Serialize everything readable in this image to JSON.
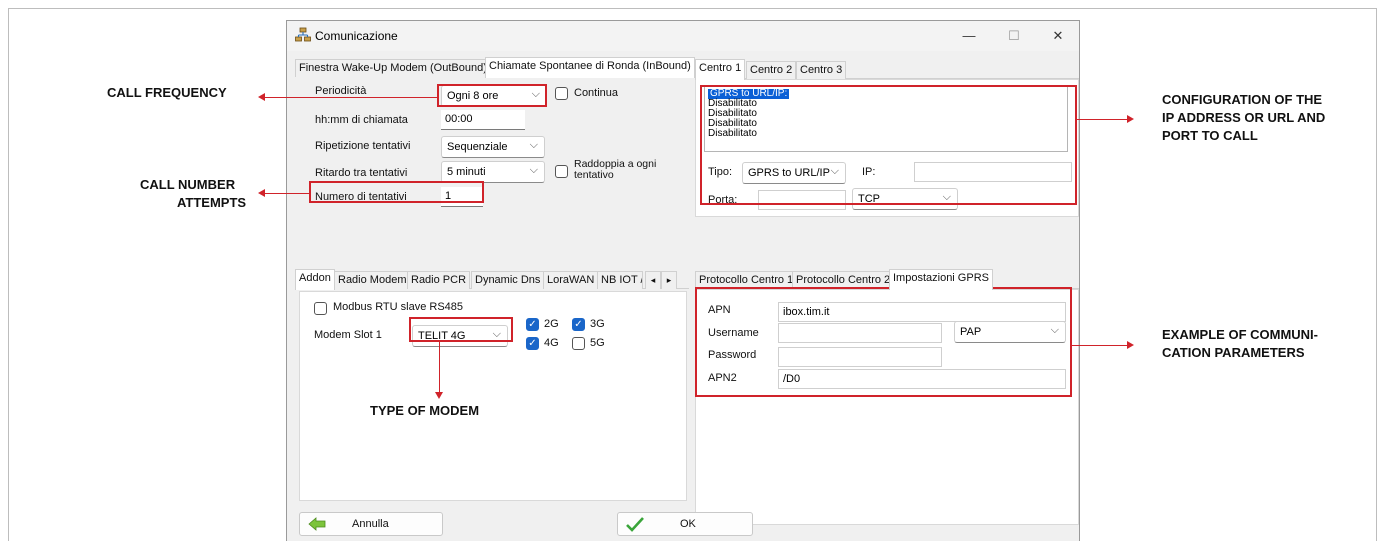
{
  "window": {
    "title": "Comunicazione",
    "controls": {
      "minimize": "—",
      "maximize": "☐",
      "close": "✕"
    }
  },
  "call_tabs": [
    "Finestra Wake-Up Modem (OutBound)",
    "Chiamate Spontanee di Ronda (InBound)"
  ],
  "call_settings": {
    "periodicita_label": "Periodicità",
    "periodicita_value": "Ogni 8 ore",
    "continua_label": "Continua",
    "orario_label": "hh:mm di chiamata",
    "orario_value": "00:00",
    "ripetizione_label": "Ripetizione tentativi",
    "ripetizione_value": "Sequenziale",
    "ritardo_label": "Ritardo tra tentativi",
    "ritardo_value": "5 minuti",
    "raddoppia_label": "Raddoppia a ogni tentativo",
    "numero_label": "Numero di tentativi",
    "numero_value": "1"
  },
  "centro_tabs": [
    "Centro 1",
    "Centro 2",
    "Centro 3"
  ],
  "centro": {
    "list": [
      "GPRS to URL/IP:",
      "Disabilitato",
      "Disabilitato",
      "Disabilitato",
      "Disabilitato"
    ],
    "tipo_label": "Tipo:",
    "tipo_value": "GPRS to URL/IP",
    "ip_label": "IP:",
    "ip_value": "",
    "porta_label": "Porta:",
    "porta_value": "",
    "proto_value": "TCP"
  },
  "addon_tabs": [
    "Addon",
    "Radio Modem",
    "Radio PCR",
    "Dynamic Dns",
    "LoraWAN",
    "NB IOT /"
  ],
  "addon_scroll": {
    "left": "◂",
    "right": "▸"
  },
  "addon": {
    "modbus_label": "Modbus RTU slave RS485",
    "modem_slot_label": "Modem Slot 1",
    "modem_value": "TELIT 4G",
    "net_2g": "2G",
    "net_3g": "3G",
    "net_4g": "4G",
    "net_5g": "5G"
  },
  "proto_tabs": [
    "Protocollo Centro 1",
    "Protocollo Centro 2",
    "Impostazioni GPRS"
  ],
  "gprs": {
    "apn_label": "APN",
    "apn_value": "ibox.tim.it",
    "username_label": "Username",
    "username_value": "",
    "auth_value": "PAP",
    "password_label": "Password",
    "password_value": "",
    "apn2_label": "APN2",
    "apn2_value": "/D0"
  },
  "buttons": {
    "annulla": "Annulla",
    "ok": "OK"
  },
  "annotations": {
    "call_frequency": "CALL FREQUENCY",
    "call_number_1": "CALL NUMBER",
    "call_number_2": "ATTEMPTS",
    "config_1": "CONFIGURATION OF THE",
    "config_2": "IP ADDRESS OR URL AND",
    "config_3": "PORT TO CALL",
    "example_1": "EXAMPLE OF COMMUNI-",
    "example_2": "CATION PARAMETERS",
    "modem_type": "TYPE OF MODEM"
  },
  "colors": {
    "annotation_red": "#d0232a",
    "selection_blue": "#0a5fd6",
    "check_blue": "#1a66c9"
  }
}
